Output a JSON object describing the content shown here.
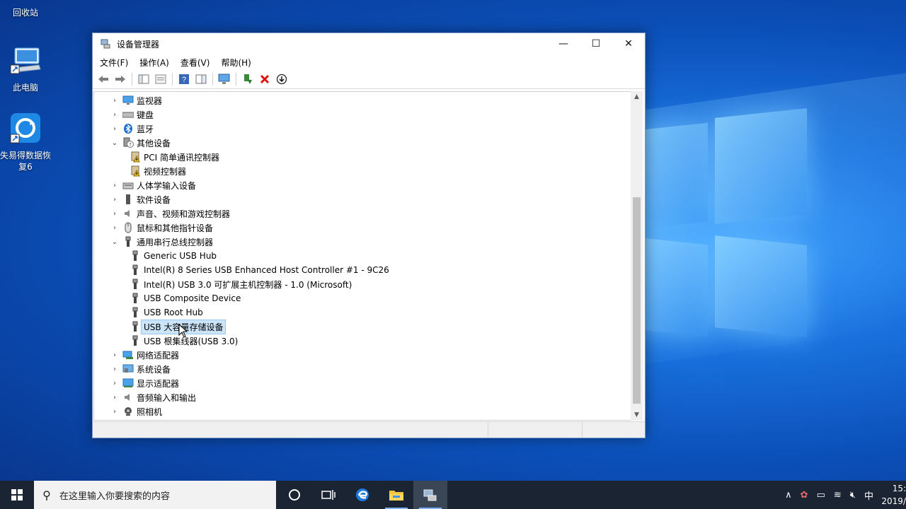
{
  "desktop": {
    "icons": [
      {
        "label": "回收站"
      },
      {
        "label": "此电脑"
      },
      {
        "label": "失易得数据恢复6"
      }
    ]
  },
  "window": {
    "title": "设备管理器",
    "controls": {
      "minimize": "—",
      "maximize": "☐",
      "close": "✕"
    },
    "menu": [
      "文件(F)",
      "操作(A)",
      "查看(V)",
      "帮助(H)"
    ],
    "tree": [
      {
        "label": "监视器",
        "expander": "›",
        "level": 0,
        "icon": "monitor-icon"
      },
      {
        "label": "键盘",
        "expander": "›",
        "level": 0,
        "icon": "keyboard-icon"
      },
      {
        "label": "蓝牙",
        "expander": "›",
        "level": 0,
        "icon": "bluetooth-icon"
      },
      {
        "label": "其他设备",
        "expander": "⌄",
        "level": 0,
        "icon": "unknown-device-icon"
      },
      {
        "label": "PCI 简单通讯控制器",
        "expander": "",
        "level": 1,
        "icon": "warning-device-icon"
      },
      {
        "label": "视频控制器",
        "expander": "",
        "level": 1,
        "icon": "warning-device-icon"
      },
      {
        "label": "人体学输入设备",
        "expander": "›",
        "level": 0,
        "icon": "hid-icon"
      },
      {
        "label": "软件设备",
        "expander": "›",
        "level": 0,
        "icon": "software-device-icon"
      },
      {
        "label": "声音、视频和游戏控制器",
        "expander": "›",
        "level": 0,
        "icon": "speaker-icon"
      },
      {
        "label": "鼠标和其他指针设备",
        "expander": "›",
        "level": 0,
        "icon": "mouse-icon"
      },
      {
        "label": "通用串行总线控制器",
        "expander": "⌄",
        "level": 0,
        "icon": "usb-icon"
      },
      {
        "label": "Generic USB Hub",
        "expander": "",
        "level": 1,
        "icon": "usb-icon"
      },
      {
        "label": "Intel(R) 8 Series USB Enhanced Host Controller #1 - 9C26",
        "expander": "",
        "level": 1,
        "icon": "usb-icon"
      },
      {
        "label": "Intel(R) USB 3.0 可扩展主机控制器 - 1.0 (Microsoft)",
        "expander": "",
        "level": 1,
        "icon": "usb-icon"
      },
      {
        "label": "USB Composite Device",
        "expander": "",
        "level": 1,
        "icon": "usb-icon"
      },
      {
        "label": "USB Root Hub",
        "expander": "",
        "level": 1,
        "icon": "usb-icon"
      },
      {
        "label": "USB 大容量存储设备",
        "expander": "",
        "level": 1,
        "icon": "usb-icon",
        "selected": true
      },
      {
        "label": "USB 根集线器(USB 3.0)",
        "expander": "",
        "level": 1,
        "icon": "usb-icon"
      },
      {
        "label": "网络适配器",
        "expander": "›",
        "level": 0,
        "icon": "network-adapter-icon"
      },
      {
        "label": "系统设备",
        "expander": "›",
        "level": 0,
        "icon": "system-device-icon"
      },
      {
        "label": "显示适配器",
        "expander": "›",
        "level": 0,
        "icon": "display-adapter-icon"
      },
      {
        "label": "音频输入和输出",
        "expander": "›",
        "level": 0,
        "icon": "audio-io-icon"
      },
      {
        "label": "照相机",
        "expander": "›",
        "level": 0,
        "icon": "camera-icon"
      }
    ]
  },
  "taskbar": {
    "search_placeholder": "在这里输入你要搜索的内容",
    "ime": "中",
    "time": "15:",
    "date": "2019/"
  },
  "colors": {
    "selection": "#cce4f7",
    "taskbar": "#1b2433"
  }
}
